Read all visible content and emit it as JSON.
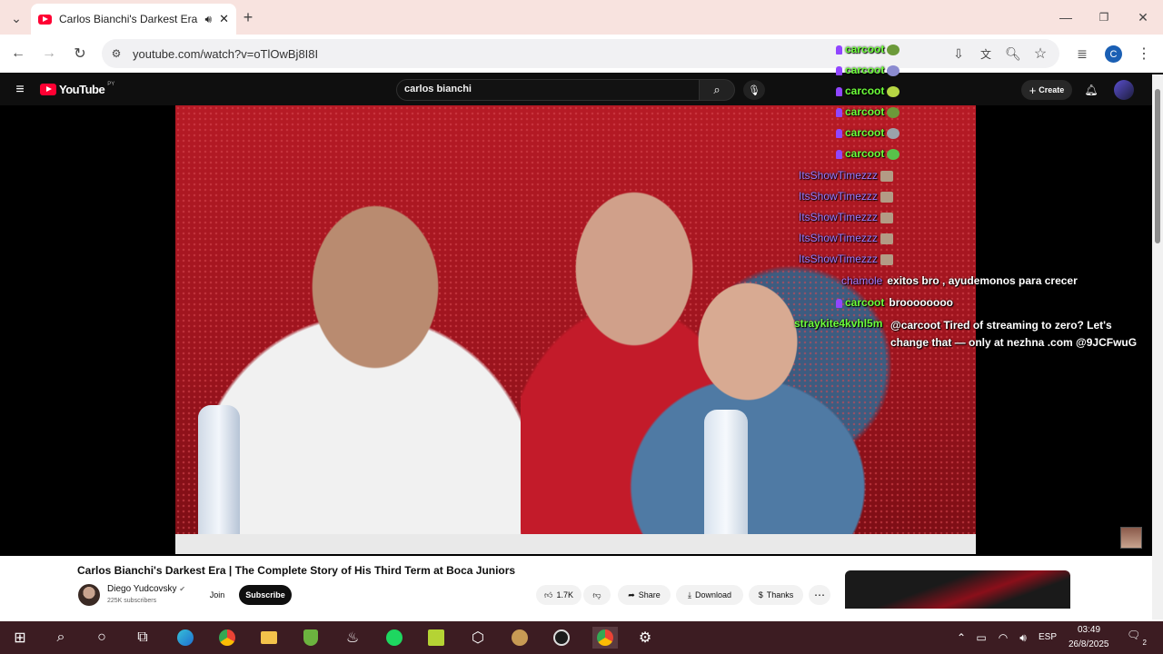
{
  "browser": {
    "tab_title": "Carlos Bianchi's Darkest Era",
    "url": "youtube.com/watch?v=oTlOwBj8I8I",
    "profile_initial": "C"
  },
  "youtube": {
    "logo": "YouTube",
    "region": "PY",
    "search_query": "carlos bianchi",
    "create_label": "Create"
  },
  "video": {
    "title": "Carlos Bianchi's Darkest Era | The Complete Story of His Third Term at Boca Juniors",
    "channel": "Diego Yudcovsky",
    "subscribers": "225K subscribers",
    "join_label": "Join",
    "subscribe_label": "Subscribe",
    "likes": "1.7K",
    "share_label": "Share",
    "download_label": "Download",
    "thanks_label": "Thanks"
  },
  "chat": [
    {
      "user": "carcoot",
      "color": "#6dff3a",
      "text": ""
    },
    {
      "user": "carcoot",
      "color": "#6dff3a",
      "text": ""
    },
    {
      "user": "carcoot",
      "color": "#6dff3a",
      "text": ""
    },
    {
      "user": "carcoot",
      "color": "#6dff3a",
      "text": ""
    },
    {
      "user": "carcoot",
      "color": "#6dff3a",
      "text": ""
    },
    {
      "user": "carcoot",
      "color": "#6dff3a",
      "text": ""
    },
    {
      "user": "ItsShowTimezzz",
      "color": "#9b7bff",
      "text": ""
    },
    {
      "user": "ItsShowTimezzz",
      "color": "#9b7bff",
      "text": ""
    },
    {
      "user": "ItsShowTimezzz",
      "color": "#9b7bff",
      "text": ""
    },
    {
      "user": "ItsShowTimezzz",
      "color": "#9b7bff",
      "text": ""
    },
    {
      "user": "ItsShowTimezzz",
      "color": "#9b7bff",
      "text": ""
    },
    {
      "user": "chamole",
      "color": "#a67bff",
      "text": "exitos bro , ayudemonos para crecer"
    },
    {
      "user": "carcoot",
      "color": "#6dff3a",
      "text": "broooooooo"
    },
    {
      "user": "straykite4kvhl5m",
      "color": "#6dff3a",
      "text": "@carcoot Tired of streaming to zero? Let's change that — only at nezhna .com @9JCFwuG"
    }
  ],
  "taskbar": {
    "language": "ESP",
    "time": "03:49",
    "date": "26/8/2025",
    "notification_count": "2"
  },
  "colors": {
    "tab_strip": "#f8e3df",
    "taskbar": "#3c1c22",
    "yt_header": "#0f0f0f",
    "yt_red": "#ff0033"
  }
}
